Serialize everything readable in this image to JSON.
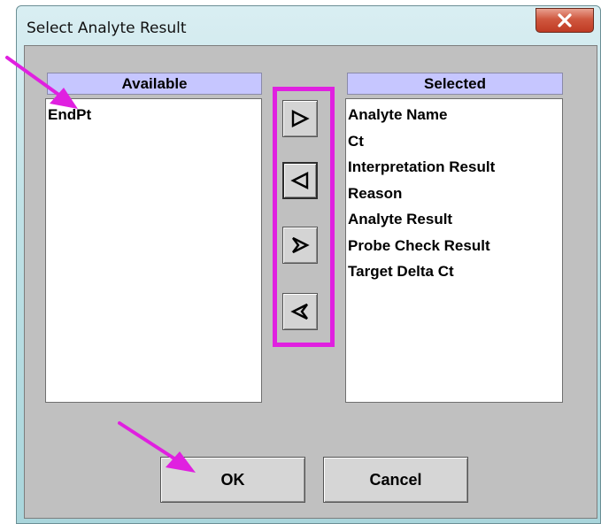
{
  "window": {
    "title": "Select Analyte Result",
    "close_glyph": "x"
  },
  "available": {
    "header": "Available",
    "items": [
      "EndPt"
    ]
  },
  "selected": {
    "header": "Selected",
    "items": [
      "Analyte Name",
      "Ct",
      "Interpretation Result",
      "Reason",
      "Analyte Result",
      "Probe Check Result",
      "Target Delta Ct"
    ]
  },
  "move_buttons": [
    {
      "icon": "move-right-icon"
    },
    {
      "icon": "move-left-icon"
    },
    {
      "icon": "move-all-right-icon"
    },
    {
      "icon": "move-all-left-icon"
    }
  ],
  "buttons": {
    "ok": "OK",
    "cancel": "Cancel"
  },
  "colors": {
    "header_bg": "#c6c6ff",
    "annotation": "#e020e0",
    "close_button": "#c9472f"
  }
}
